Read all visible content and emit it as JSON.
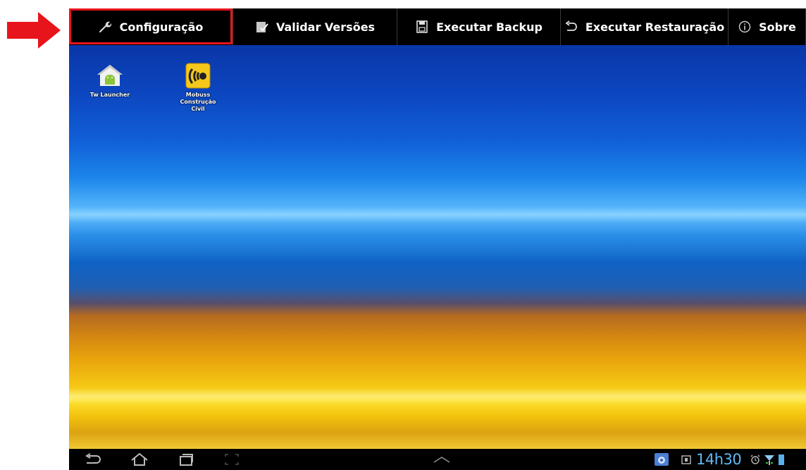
{
  "action_bar": {
    "tabs": [
      {
        "label": "Configuração",
        "icon": "wrench-icon"
      },
      {
        "label": "Validar Versões",
        "icon": "checklist-icon"
      },
      {
        "label": "Executar Backup",
        "icon": "floppy-disk-icon"
      },
      {
        "label": "Executar Restauração",
        "icon": "undo-arrow-icon"
      },
      {
        "label": "Sobre",
        "icon": "info-icon"
      }
    ],
    "highlighted_tab": "Configuração"
  },
  "desktop": {
    "apps": [
      {
        "label": "Tw Launcher",
        "icon": "android-home-icon"
      },
      {
        "label": "Mobuss\nConstrução\nCivil",
        "icon": "mobuss-logo-icon"
      }
    ]
  },
  "system_bar": {
    "clock": "14h30"
  },
  "colors": {
    "annotation": "#e8141b",
    "clock": "#63b8f2",
    "bar_background": "#000000"
  }
}
